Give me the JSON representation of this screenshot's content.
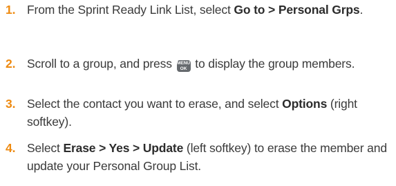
{
  "steps": [
    {
      "number": "1.",
      "pre": "From the Sprint Ready Link List, select ",
      "bold": "Go to > Personal Grps",
      "post": "."
    },
    {
      "number": "2.",
      "pre": "Scroll to a group, and press ",
      "key_top": "MENU",
      "key_bottom": "OK",
      "post": " to display the group members."
    },
    {
      "number": "3.",
      "pre": "Select the contact you want to erase, and select ",
      "bold": "Options",
      "post": " (right softkey)."
    },
    {
      "number": "4.",
      "pre": "Select ",
      "bold": "Erase > Yes > Update",
      "post": " (left softkey) to erase the member and update your Personal Group List."
    }
  ]
}
